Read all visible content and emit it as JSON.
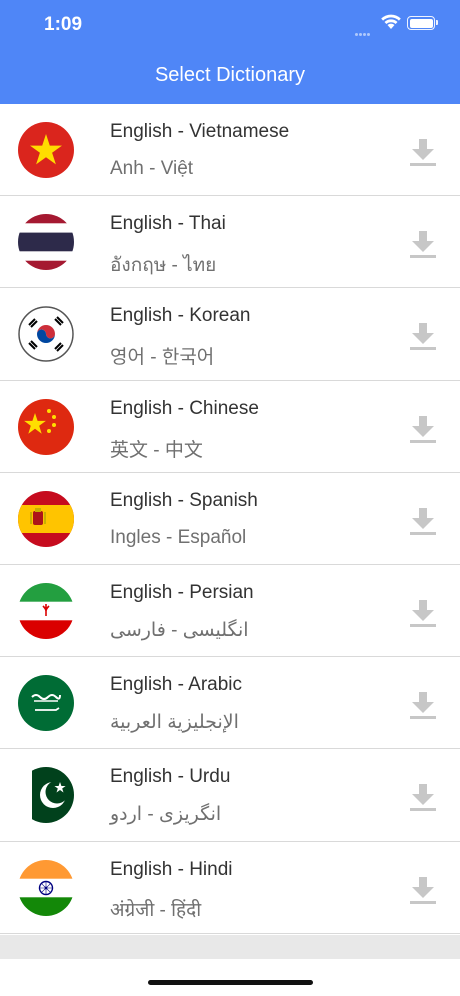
{
  "status_bar": {
    "time": "1:09"
  },
  "nav": {
    "title": "Select Dictionary"
  },
  "dictionaries": [
    {
      "title": "English - Vietnamese",
      "subtitle": "Anh - Việt",
      "flag": "vietnam-flag-icon"
    },
    {
      "title": "English - Thai",
      "subtitle": "อังกฤษ - ไทย",
      "flag": "thailand-flag-icon"
    },
    {
      "title": "English - Korean",
      "subtitle": "영어 - 한국어",
      "flag": "south-korea-flag-icon"
    },
    {
      "title": "English - Chinese",
      "subtitle": "英文 - 中文",
      "flag": "china-flag-icon"
    },
    {
      "title": "English - Spanish",
      "subtitle": "Ingles - Español",
      "flag": "spain-flag-icon"
    },
    {
      "title": "English - Persian",
      "subtitle": "انگلیسی - فارسی",
      "flag": "iran-flag-icon"
    },
    {
      "title": "English - Arabic",
      "subtitle": "الإنجليزية العربية",
      "flag": "saudi-arabia-flag-icon"
    },
    {
      "title": "English - Urdu",
      "subtitle": "انگریزی - اردو",
      "flag": "pakistan-flag-icon"
    },
    {
      "title": "English - Hindi",
      "subtitle": "अंग्रेजी - हिंदी",
      "flag": "india-flag-icon"
    }
  ],
  "icons": {
    "download": "download-icon"
  },
  "colors": {
    "header": "#4f86f7",
    "title_text": "#333333",
    "subtitle_text": "#707070",
    "download_icon": "#c7c7c7"
  }
}
